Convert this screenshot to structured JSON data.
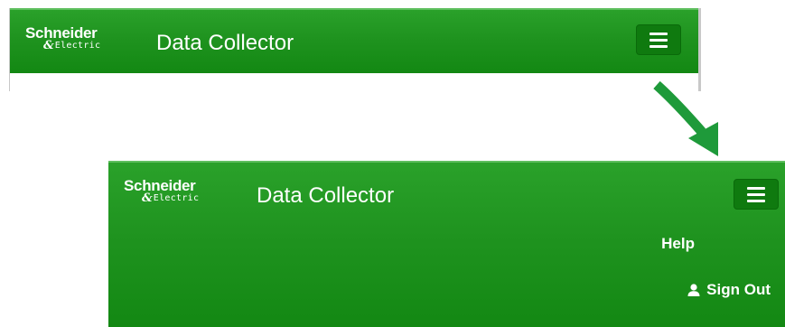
{
  "brand": {
    "logo_top": "Schneider",
    "logo_mark": "&",
    "logo_sub": "Electric",
    "title": "Data Collector"
  },
  "nav_menu": {
    "help_label": "Help",
    "signout_label": "Sign Out"
  },
  "icons": {
    "menu": "hamburger-menu-icon",
    "user": "user-icon",
    "arrow": "down-arrow-icon"
  },
  "colors": {
    "navbar_green": "#1f931f",
    "button_green": "#0f7a0f",
    "arrow_green": "#1e9a3a",
    "text": "#ffffff"
  }
}
